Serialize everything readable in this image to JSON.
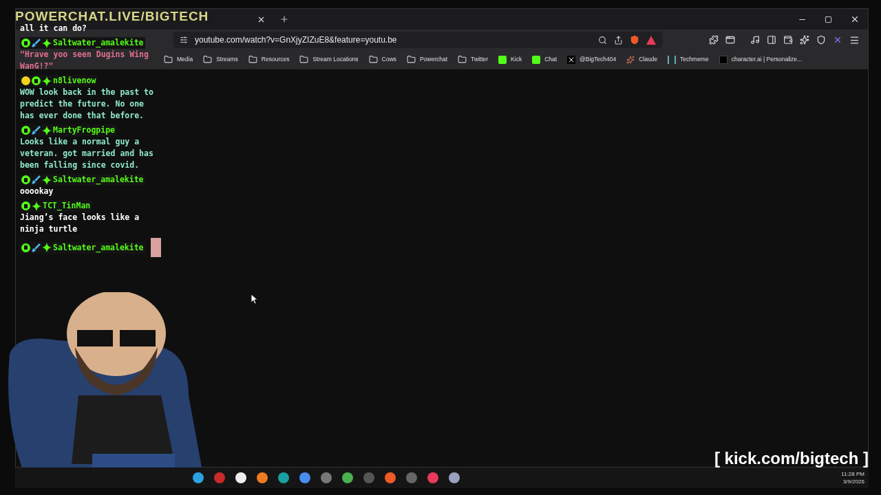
{
  "overlay_title": "POWERCHAT.LIVE/BIGTECH",
  "browser": {
    "address": "youtube.com/watch?v=GnXjyZIZuE8&feature=youtu.be",
    "bookmarks": [
      {
        "label": "Media",
        "kind": "folder"
      },
      {
        "label": "Streams",
        "kind": "folder"
      },
      {
        "label": "Resources",
        "kind": "folder"
      },
      {
        "label": "Stream Locations",
        "kind": "folder"
      },
      {
        "label": "Cows",
        "kind": "folder"
      },
      {
        "label": "Powerchat",
        "kind": "folder"
      },
      {
        "label": "Twitter",
        "kind": "folder"
      },
      {
        "label": "Kick",
        "kind": "kick"
      },
      {
        "label": "Chat",
        "kind": "kick"
      },
      {
        "label": "@BigTech404",
        "kind": "x"
      },
      {
        "label": "Claude",
        "kind": "claude"
      },
      {
        "label": "Techmeme",
        "kind": "techmeme"
      },
      {
        "label": "character.ai | Personalize...",
        "kind": "cai"
      }
    ]
  },
  "chat": [
    {
      "kind": "text",
      "text": "all it can do?",
      "color": "#ffffff"
    },
    {
      "kind": "message",
      "user": "Saltwater_amalekite",
      "badges": [
        {
          "kind": "kick"
        },
        {
          "kind": "sword"
        },
        {
          "kind": "diamond"
        }
      ],
      "text": "\"Hrave yoo seen Dugins Wing WanG!?\"",
      "color": "#e0708c",
      "emote": false
    },
    {
      "kind": "message",
      "user": "n8livenow",
      "badges": [
        {
          "kind": "sun"
        },
        {
          "kind": "kick"
        },
        {
          "kind": "diamond"
        }
      ],
      "text": "WOW look back in the past to predict the future. No one has ever done that before.",
      "color": "#8fe8c8",
      "emote": false
    },
    {
      "kind": "message",
      "user": "MartyFrogpipe",
      "badges": [
        {
          "kind": "kick"
        },
        {
          "kind": "sword"
        },
        {
          "kind": "diamond"
        }
      ],
      "text": "Looks like a normal guy a veteran. got married and has been falling since covid.",
      "color": "#8fe8c8",
      "emote": false
    },
    {
      "kind": "message",
      "user": "Saltwater_amalekite",
      "badges": [
        {
          "kind": "kick"
        },
        {
          "kind": "sword"
        },
        {
          "kind": "diamond"
        }
      ],
      "text": "ooookay",
      "color": "#ffffff",
      "emote": false
    },
    {
      "kind": "message",
      "user": "TCT_TinMan",
      "badges": [
        {
          "kind": "kick"
        },
        {
          "kind": "diamond"
        }
      ],
      "text": "Jiang’s face looks like a ninja turtle",
      "color": "#ffffff",
      "emote": false
    },
    {
      "kind": "message",
      "user": "Saltwater_amalekite",
      "badges": [
        {
          "kind": "kick"
        },
        {
          "kind": "sword"
        },
        {
          "kind": "diamond"
        }
      ],
      "emote": true
    }
  ],
  "stream_link": "[ kick.com/bigtech ]",
  "taskbar": {
    "time": "11:28 PM",
    "date": "3/9/2026"
  }
}
